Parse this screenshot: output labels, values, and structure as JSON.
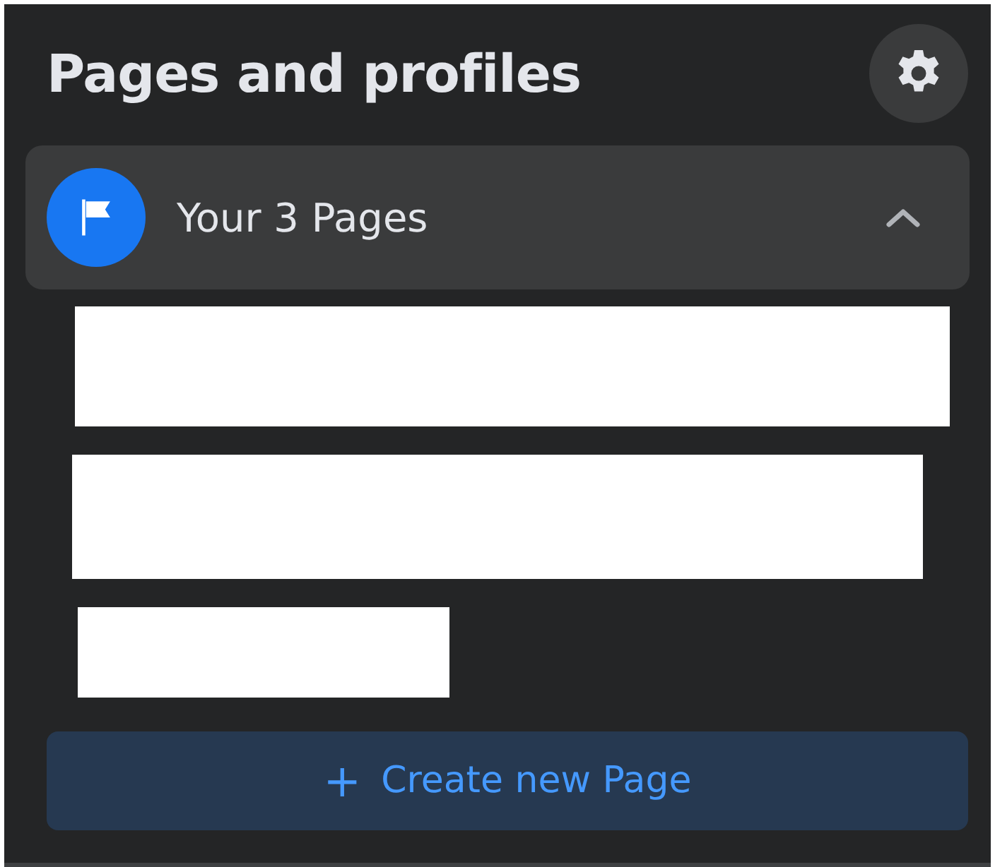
{
  "title": "Pages and profiles",
  "pages_group": {
    "label": "Your 3 Pages",
    "expanded": true
  },
  "pages": [
    {
      "kind": "redacted"
    },
    {
      "kind": "redacted"
    },
    {
      "kind": "redacted"
    }
  ],
  "create_button": {
    "icon": "+",
    "label": "Create new Page"
  }
}
